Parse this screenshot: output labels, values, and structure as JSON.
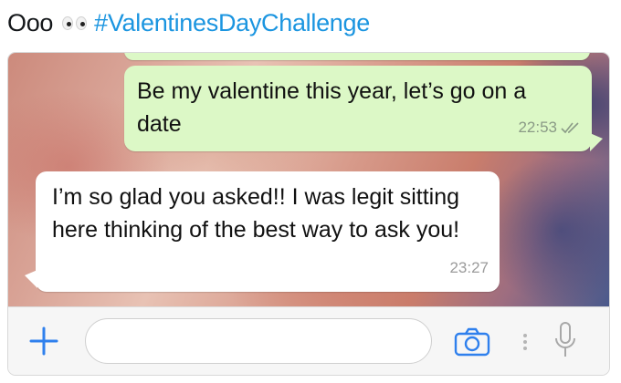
{
  "tweet": {
    "text": "Ooo",
    "emoji_icon": "eyes-icon",
    "hashtag": "#ValentinesDayChallenge"
  },
  "chat": {
    "messages": [
      {
        "direction": "outgoing",
        "text": "Be my valentine this year, let’s go on a date",
        "time": "22:53",
        "status_icon": "double-check-icon"
      },
      {
        "direction": "incoming",
        "text": "I’m so glad you asked!! I was legit sitting here thinking of the best way to ask you!",
        "time": "23:27"
      }
    ]
  },
  "input_bar": {
    "attach_icon": "plus-icon",
    "message_value": "",
    "camera_icon": "camera-icon",
    "more_icon": "more-vertical-icon",
    "mic_icon": "microphone-icon"
  },
  "colors": {
    "hashtag": "#1b95e0",
    "outgoing_bubble": "#dcf8c6",
    "incoming_bubble": "#ffffff",
    "accent": "#2f80ed"
  }
}
